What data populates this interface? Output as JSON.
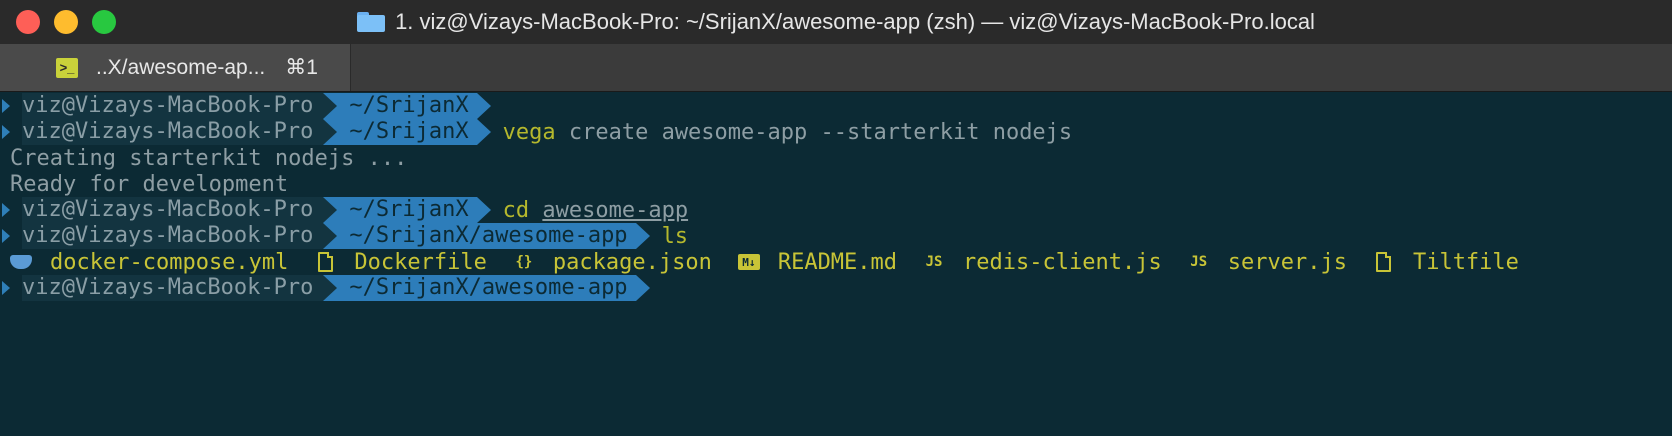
{
  "window": {
    "title": "1. viz@Vizays-MacBook-Pro: ~/SrijanX/awesome-app (zsh) — viz@Vizays-MacBook-Pro.local",
    "folder_icon": "folder-icon"
  },
  "tab": {
    "label": "..X/awesome-ap...",
    "shortcut": "⌘1",
    "icon": "terminal-icon"
  },
  "terminal": {
    "prompt_user": "viz@Vizays-MacBook-Pro",
    "lines": [
      {
        "dir": "~/SrijanX",
        "cmd_kw": "",
        "cmd_rest": ""
      },
      {
        "dir": "~/SrijanX",
        "cmd_kw": "vega",
        "cmd_rest": " create awesome-app --starterkit nodejs"
      },
      {
        "output": "Creating starterkit nodejs ..."
      },
      {
        "output": "Ready for development"
      },
      {
        "dir": "~/SrijanX",
        "cmd_kw": "cd",
        "cmd_rest": "awesome-app"
      },
      {
        "dir": "~/SrijanX/awesome-app",
        "cmd_kw": "ls",
        "cmd_rest": ""
      },
      {
        "dir": "~/SrijanX/awesome-app",
        "cmd_kw": "",
        "cmd_rest": ""
      }
    ],
    "files": [
      {
        "name": "docker-compose.yml",
        "icon": "docker-icon"
      },
      {
        "name": "Dockerfile",
        "icon": "file-icon"
      },
      {
        "name": "package.json",
        "icon": "json-braces-icon",
        "glyph": "{}"
      },
      {
        "name": "README.md",
        "icon": "markdown-icon",
        "glyph": "M↓"
      },
      {
        "name": "redis-client.js",
        "icon": "js-icon",
        "glyph": "JS"
      },
      {
        "name": "server.js",
        "icon": "js-icon",
        "glyph": "JS"
      },
      {
        "name": "Tiltfile",
        "icon": "file-icon"
      }
    ]
  },
  "colors": {
    "background": "#0c2a34",
    "dir_segment": "#2d7dba",
    "keyword": "#b5b82d",
    "files": "#c8c437"
  }
}
